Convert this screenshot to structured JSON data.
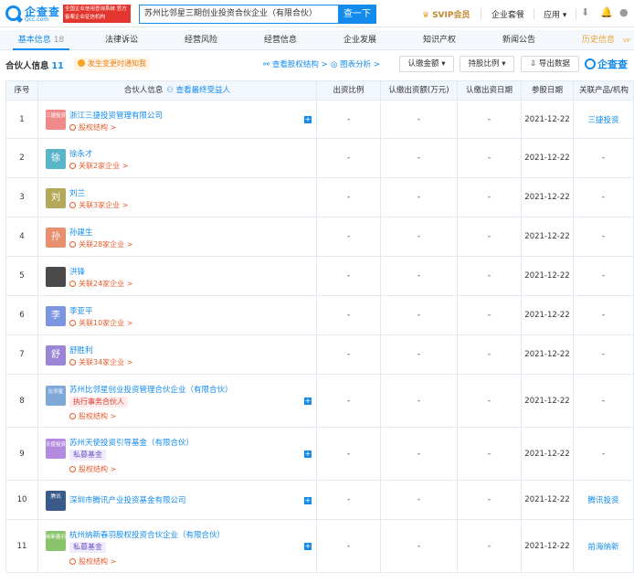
{
  "topbar": {
    "logo_name": "企查查",
    "logo_sub": "Qcc.com",
    "notice": "全国企业信用查询系统 官方备案企业征信机构",
    "search_value": "苏州比邻星三期创业投资合伙企业（有限合伙）",
    "search_button": "查一下",
    "svip": "SVIP会员",
    "nav": [
      "企业套餐",
      "应用"
    ]
  },
  "tabs": [
    {
      "label": "基本信息",
      "count": "18"
    },
    {
      "label": "法律诉讼"
    },
    {
      "label": "经营风险"
    },
    {
      "label": "经营信息"
    },
    {
      "label": "企业发展"
    },
    {
      "label": "知识产权"
    },
    {
      "label": "新闻公告"
    },
    {
      "label": "历史信息",
      "badge": "VIP"
    }
  ],
  "section": {
    "title": "合伙人信息",
    "count": "11",
    "warning": "发生变更时通知我",
    "links": [
      "查看股权结构",
      "图表分析"
    ],
    "buttons": [
      "认缴金额",
      "持股比例",
      "导出数据"
    ],
    "brand": "企查查"
  },
  "table": {
    "headers": [
      "序号",
      "合伙人信息",
      "出资比例",
      "认缴出资额(万元)",
      "认缴出资日期",
      "参股日期",
      "关联产品/机构"
    ],
    "beneficiary_link": "查看最终受益人",
    "rows": [
      {
        "no": "1",
        "avatar": "三捷投资",
        "avatar_color": "#f08a8a",
        "name": "浙江三捷投资管理有限公司",
        "sub": "股权结构 >",
        "ratio": "-",
        "amount": "-",
        "date": "-",
        "join": "2021-12-22",
        "product": "三捷投资"
      },
      {
        "no": "2",
        "avatar": "徐",
        "avatar_color": "#5bb5c8",
        "name": "徐永才",
        "sub": "关联2家企业 >",
        "ratio": "-",
        "amount": "-",
        "date": "-",
        "join": "2021-12-22",
        "product": "-"
      },
      {
        "no": "3",
        "avatar": "刘",
        "avatar_color": "#b4a85a",
        "name": "刘兰",
        "sub": "关联3家企业 >",
        "ratio": "-",
        "amount": "-",
        "date": "-",
        "join": "2021-12-22",
        "product": "-"
      },
      {
        "no": "4",
        "avatar": "孙",
        "avatar_color": "#e88f6f",
        "name": "孙建生",
        "sub": "关联28家企业 >",
        "ratio": "-",
        "amount": "-",
        "date": "-",
        "join": "2021-12-22",
        "product": "-"
      },
      {
        "no": "5",
        "avatar": "",
        "avatar_color": "#4a4a4a",
        "name": "洪锋",
        "sub": "关联24家企业 >",
        "ratio": "-",
        "amount": "-",
        "date": "-",
        "join": "2021-12-22",
        "product": "-"
      },
      {
        "no": "6",
        "avatar": "李",
        "avatar_color": "#7b95e0",
        "name": "李亚平",
        "sub": "关联10家企业 >",
        "ratio": "-",
        "amount": "-",
        "date": "-",
        "join": "2021-12-22",
        "product": "-"
      },
      {
        "no": "7",
        "avatar": "舒",
        "avatar_color": "#9b86d6",
        "name": "舒胜利",
        "sub": "关联34家企业 >",
        "ratio": "-",
        "amount": "-",
        "date": "-",
        "join": "2021-12-22",
        "product": "-"
      },
      {
        "no": "8",
        "avatar": "比邻星",
        "avatar_color": "#7fa8d8",
        "name": "苏州比邻星创业投资管理合伙企业（有限合伙）",
        "tag": "执行事务合伙人",
        "tag_type": "red",
        "sub": "股权结构 >",
        "ratio": "-",
        "amount": "-",
        "date": "-",
        "join": "2021-12-22",
        "product": "-"
      },
      {
        "no": "9",
        "avatar": "天使投资",
        "avatar_color": "#b28be0",
        "name": "苏州天使投资引导基金（有限合伙）",
        "tag": "私募基金",
        "tag_type": "purple",
        "sub": "股权结构 >",
        "ratio": "-",
        "amount": "-",
        "date": "-",
        "join": "2021-12-22",
        "product": "-"
      },
      {
        "no": "10",
        "avatar": "腾讯",
        "avatar_color": "#3a5a8a",
        "name": "深圳市腾讯产业投资基金有限公司",
        "sub": "",
        "ratio": "-",
        "amount": "-",
        "date": "-",
        "join": "2021-12-22",
        "product": "腾讯投资"
      },
      {
        "no": "11",
        "avatar": "纳新春羽",
        "avatar_color": "#8ac46a",
        "name": "杭州纳新春羽股权投资合伙企业（有限合伙）",
        "tag": "私募基金",
        "tag_type": "purple",
        "sub": "股权结构 >",
        "ratio": "-",
        "amount": "-",
        "date": "-",
        "join": "2021-12-22",
        "product": "前海纳新"
      }
    ]
  }
}
